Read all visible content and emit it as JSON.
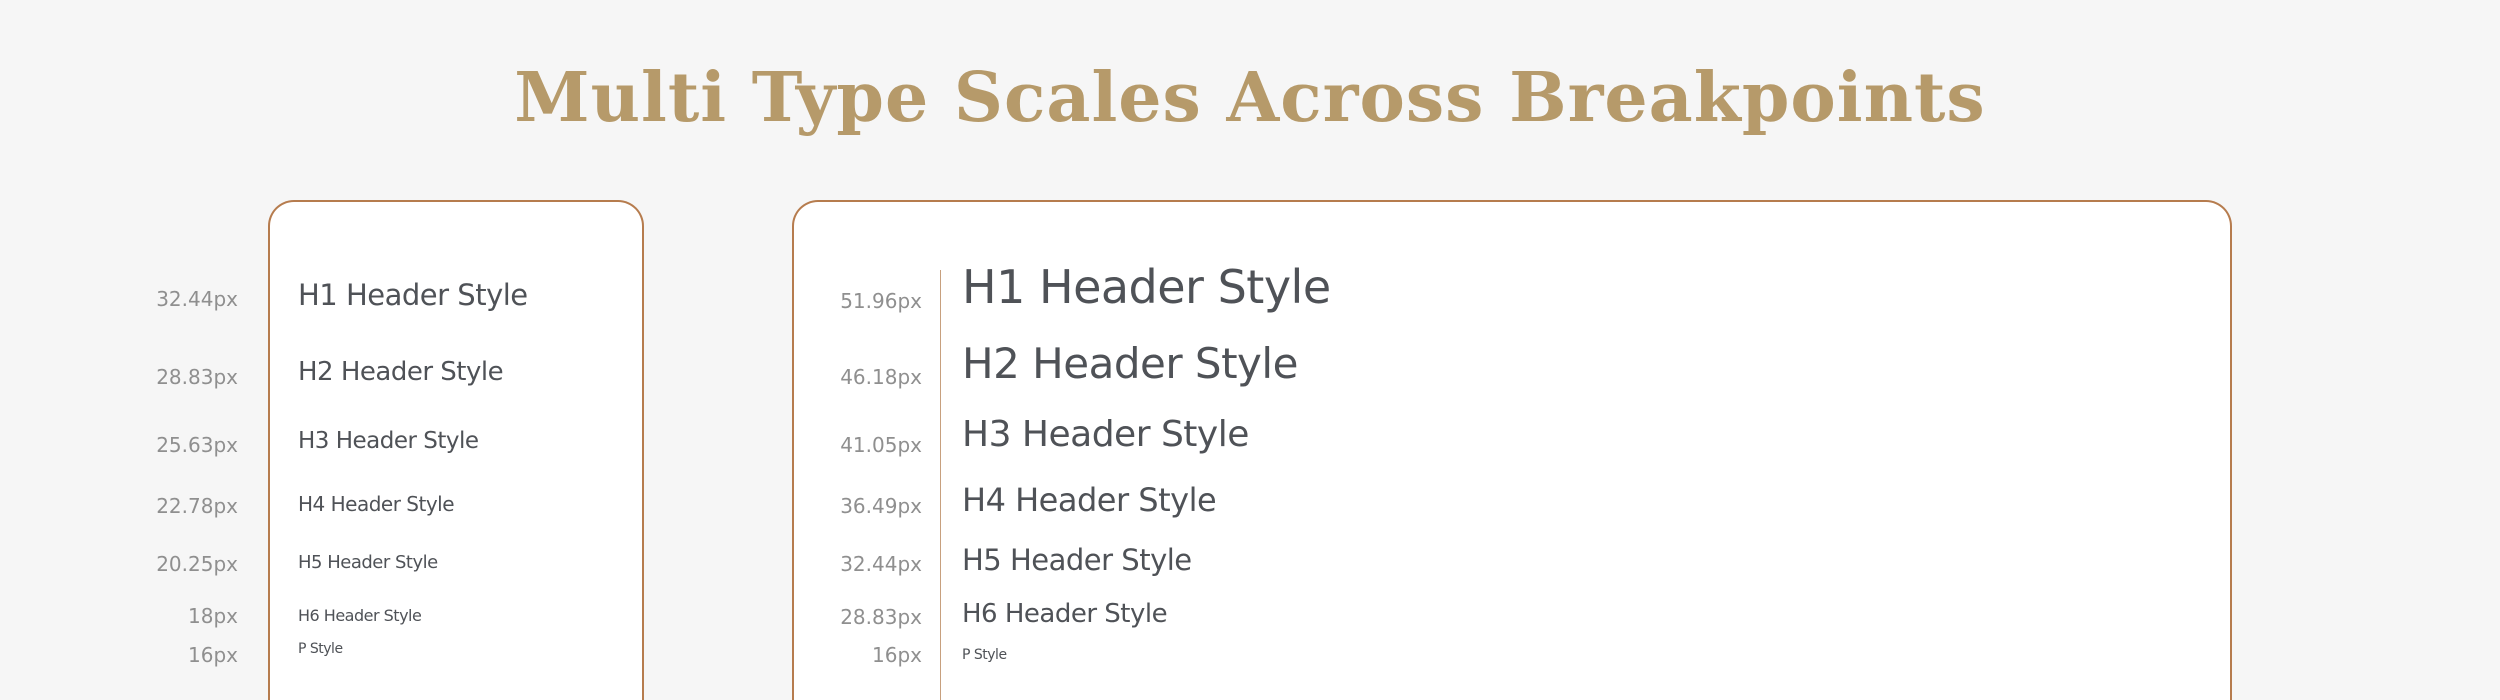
{
  "title": "Multi Type Scales Across Breakpoints",
  "colors": {
    "title": "#b69a6a",
    "panel_border": "#b67c4e",
    "text": "#4f5257",
    "size_label": "#8f8f8f",
    "background": "#f6f6f6",
    "panel_background": "#ffffff"
  },
  "mobile": {
    "rows": [
      {
        "size": "32.44px",
        "label": "H1 Header Style"
      },
      {
        "size": "28.83px",
        "label": "H2 Header Style"
      },
      {
        "size": "25.63px",
        "label": "H3 Header Style"
      },
      {
        "size": "22.78px",
        "label": "H4 Header Style"
      },
      {
        "size": "20.25px",
        "label": "H5 Header Style"
      },
      {
        "size": "18px",
        "label": "H6 Header Style"
      },
      {
        "size": "16px",
        "label": "P Style"
      }
    ]
  },
  "desktop": {
    "rows": [
      {
        "size": "51.96px",
        "label": "H1 Header Style"
      },
      {
        "size": "46.18px",
        "label": "H2 Header Style"
      },
      {
        "size": "41.05px",
        "label": "H3 Header Style"
      },
      {
        "size": "36.49px",
        "label": "H4 Header Style"
      },
      {
        "size": "32.44px",
        "label": "H5 Header Style"
      },
      {
        "size": "28.83px",
        "label": "H6 Header Style"
      },
      {
        "size": "16px",
        "label": "P Style"
      }
    ]
  }
}
